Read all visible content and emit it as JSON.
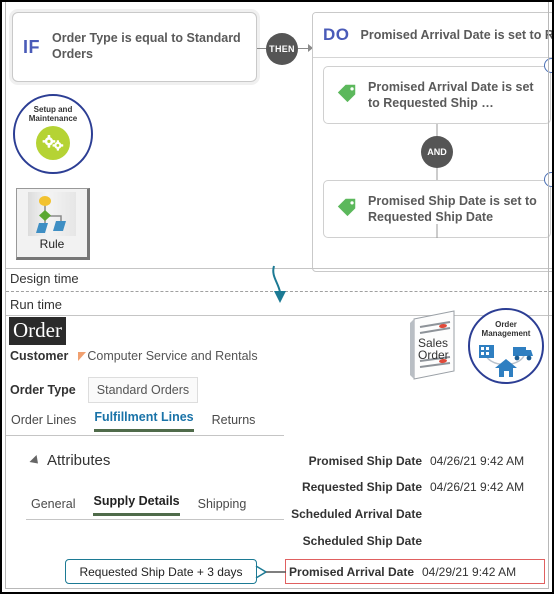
{
  "design_time": {
    "section_label": "Design time",
    "if_badge": "IF",
    "if_condition": "Order Type is equal to Standard Orders",
    "then_connector": "THEN",
    "do_badge": "DO",
    "do_title": "Promised Arrival Date is set to R",
    "and_connector": "AND",
    "actions": [
      {
        "text": "Promised Arrival Date is set to Requested Ship …"
      },
      {
        "text": "Promised Ship Date is set to Requested Ship Date"
      }
    ],
    "setup_icon": {
      "line1": "Setup and",
      "line2": "Maintenance",
      "icon": "gears-icon"
    },
    "rule_icon": {
      "label": "Rule",
      "icon": "rule-flowchart-icon"
    }
  },
  "run_time": {
    "section_label": "Run time",
    "page_title": "Order",
    "customer": {
      "label": "Customer",
      "value": "Computer Service and Rentals"
    },
    "order_type": {
      "label": "Order Type",
      "value": "Standard Orders",
      "placeholder": "Standard Orders"
    },
    "main_tabs": [
      {
        "label": "Order Lines",
        "active": false
      },
      {
        "label": "Fulfillment Lines",
        "active": true
      },
      {
        "label": "Returns",
        "active": false
      }
    ],
    "attributes_section": "Attributes",
    "sub_tabs": [
      {
        "label": "General",
        "active": false
      },
      {
        "label": "Supply Details",
        "active": true
      },
      {
        "label": "Shipping",
        "active": false
      }
    ],
    "dates": [
      {
        "label": "Promised Ship Date",
        "value": "04/26/21 9:42 AM",
        "highlighted": false
      },
      {
        "label": "Requested Ship Date",
        "value": "04/26/21 9:42 AM",
        "highlighted": false
      },
      {
        "label": "Scheduled Arrival Date",
        "value": "",
        "highlighted": false
      },
      {
        "label": "Scheduled Ship Date",
        "value": "",
        "highlighted": false
      }
    ],
    "highlighted_date": {
      "label": "Promised Arrival Date",
      "value": "04/29/21 9:42 AM"
    },
    "callout": "Requested  Ship Date + 3 days",
    "sales_order_icon": {
      "line1": "Sales",
      "line2": "Order"
    },
    "order_management_icon": {
      "line1": "Order",
      "line2": "Management"
    }
  },
  "colors": {
    "badge_blue": "#4a5bb8",
    "connector_gray": "#555555",
    "tag_green": "#5cb85c",
    "accent_blue": "#1a73a8",
    "tab_underline": "#4f6b4a",
    "callout_teal": "#1c7a94",
    "highlight_red": "#e06060",
    "circle_navy": "#2c3e94",
    "gear_green": "#b5d334",
    "flag_orange": "#f0a070"
  }
}
